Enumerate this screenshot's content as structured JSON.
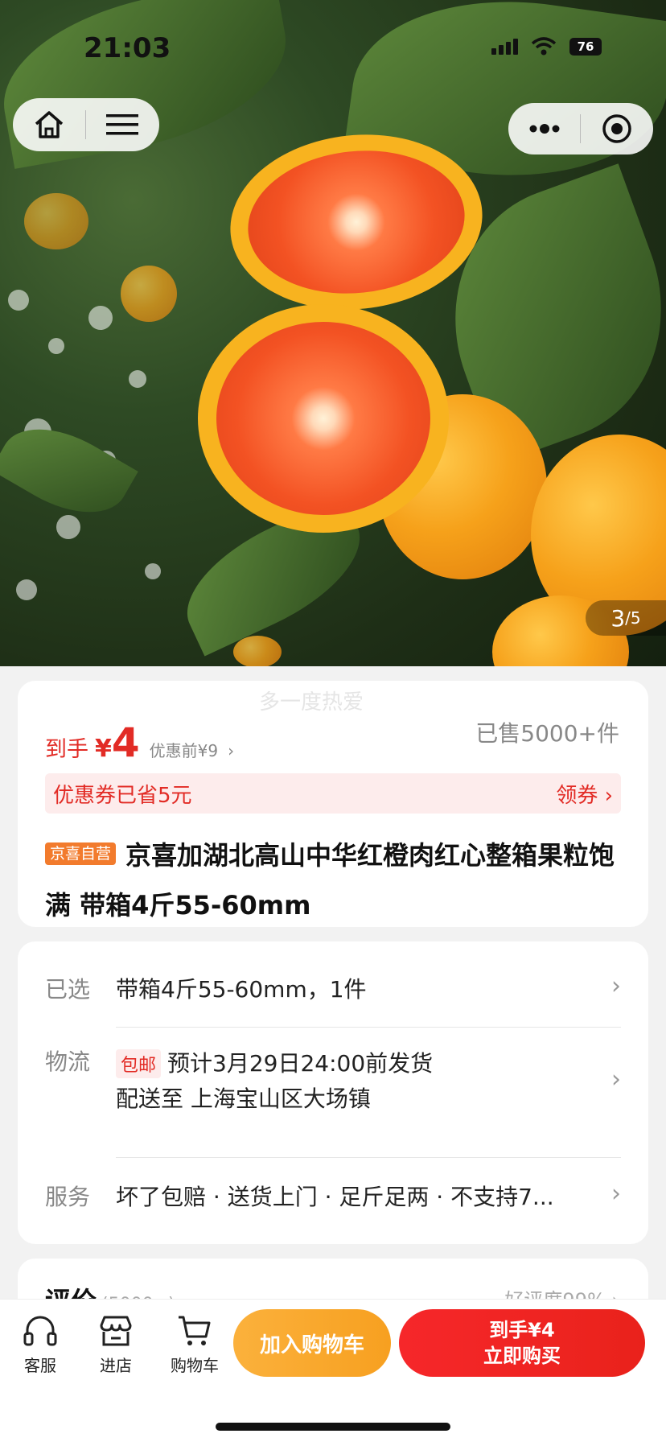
{
  "status": {
    "time": "21:03",
    "battery": "76"
  },
  "gallery": {
    "current": "3",
    "total": "/5"
  },
  "watermark": "多一度热爱",
  "price": {
    "label": "到手",
    "currency": "¥",
    "amount": "4",
    "before": "优惠前¥9",
    "sold": "已售5000+件"
  },
  "coupon": {
    "text": "优惠券已省5元",
    "action": "领券"
  },
  "product": {
    "tag": "京喜自营",
    "title": "京喜加湖北高山中华红橙肉红心整箱果粒饱满 带箱4斤55-60mm"
  },
  "details": {
    "selected_label": "已选",
    "selected_value": "带箱4斤55-60mm，1件",
    "logistics_label": "物流",
    "logistics_badge": "包邮",
    "logistics_eta": "预计3月29日24:00前发货",
    "logistics_dest": "配送至 上海宝山区大场镇",
    "service_label": "服务",
    "service_value": "坏了包赔 · 送货上门 · 足斤足两 · 不支持7..."
  },
  "reviews": {
    "title": "评价",
    "count": "(5000+)",
    "rate": "好评度99%"
  },
  "bottom_bar": {
    "service": "客服",
    "store": "进店",
    "cart": "购物车",
    "add_to_cart": "加入购物车",
    "buy_price": "到手¥4",
    "buy_now": "立即购买"
  },
  "colors": {
    "accent_red": "#e22b25",
    "cart_orange": "#f7a020"
  },
  "icons": [
    "home-icon",
    "menu-icon",
    "more-icon",
    "target-icon",
    "headset-icon",
    "store-icon",
    "cart-icon",
    "chevron-right-icon"
  ]
}
